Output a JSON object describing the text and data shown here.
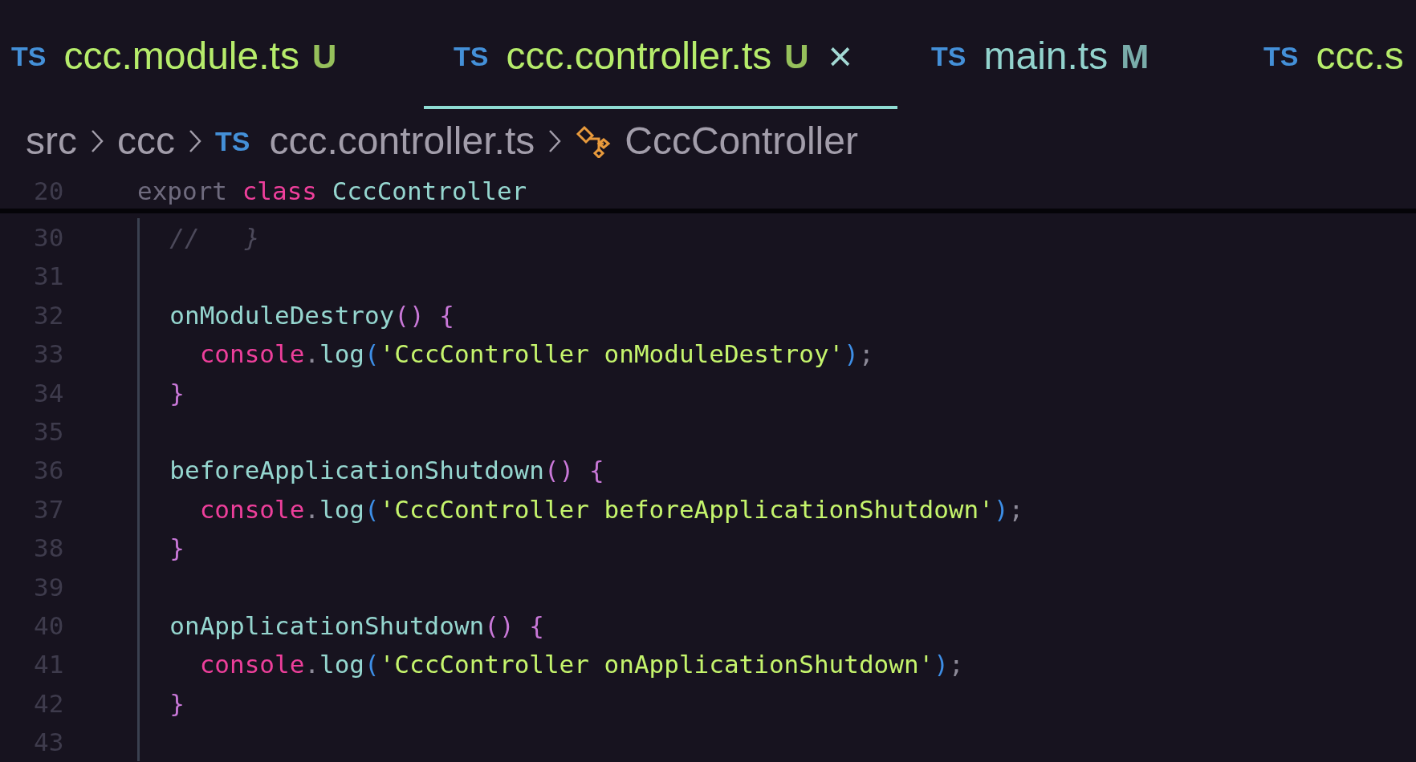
{
  "tabs": [
    {
      "icon": "TS",
      "label": "ccc.module.ts",
      "status": "U",
      "color": "#b6ec6b",
      "selected": false,
      "closable": false
    },
    {
      "icon": "TS",
      "label": "ccc.controller.ts",
      "status": "U",
      "color": "#b6ec6b",
      "selected": true,
      "closable": true,
      "close": "×"
    },
    {
      "icon": "TS",
      "label": "main.ts",
      "status": "M",
      "color": "#92d3cd",
      "selected": false,
      "closable": false
    },
    {
      "icon": "TS",
      "label": "ccc.s",
      "color": "#b6ec6b",
      "selected": false,
      "closable": false
    }
  ],
  "breadcrumb": [
    {
      "kind": "folder",
      "label": "src"
    },
    {
      "kind": "folder",
      "label": "ccc"
    },
    {
      "kind": "file",
      "icon": "TS",
      "label": "ccc.controller.ts"
    },
    {
      "kind": "symbol",
      "label": "CccController"
    }
  ],
  "sticky_line": {
    "number": "20",
    "tokens": [
      {
        "kind": "muted",
        "text": "export "
      },
      {
        "kind": "keyword",
        "text": "class "
      },
      {
        "kind": "function",
        "text": "CccController"
      }
    ]
  },
  "lines": [
    {
      "number": "30",
      "tokens": [
        {
          "kind": "comment",
          "text": "  //   }"
        }
      ]
    },
    {
      "number": "31"
    },
    {
      "number": "32",
      "tokens": [
        {
          "kind": "function",
          "text": "  onModuleDestroy"
        },
        {
          "kind": "bracket",
          "text": "() {"
        }
      ]
    },
    {
      "number": "33",
      "tokens": [
        {
          "kind": "keyword",
          "text": "    console"
        },
        {
          "kind": "punct",
          "text": "."
        },
        {
          "kind": "function",
          "text": "log"
        },
        {
          "kind": "paren",
          "text": "("
        },
        {
          "kind": "string",
          "text": "'CccController onModuleDestroy'"
        },
        {
          "kind": "paren",
          "text": ")"
        },
        {
          "kind": "punct",
          "text": ";"
        }
      ]
    },
    {
      "number": "34",
      "tokens": [
        {
          "kind": "bracket",
          "text": "  }"
        }
      ]
    },
    {
      "number": "35"
    },
    {
      "number": "36",
      "tokens": [
        {
          "kind": "function",
          "text": "  beforeApplicationShutdown"
        },
        {
          "kind": "bracket",
          "text": "() {"
        }
      ]
    },
    {
      "number": "37",
      "tokens": [
        {
          "kind": "keyword",
          "text": "    console"
        },
        {
          "kind": "punct",
          "text": "."
        },
        {
          "kind": "function",
          "text": "log"
        },
        {
          "kind": "paren",
          "text": "("
        },
        {
          "kind": "string",
          "text": "'CccController beforeApplicationShutdown'"
        },
        {
          "kind": "paren",
          "text": ")"
        },
        {
          "kind": "punct",
          "text": ";"
        }
      ]
    },
    {
      "number": "38",
      "tokens": [
        {
          "kind": "bracket",
          "text": "  }"
        }
      ]
    },
    {
      "number": "39"
    },
    {
      "number": "40",
      "tokens": [
        {
          "kind": "function",
          "text": "  onApplicationShutdown"
        },
        {
          "kind": "bracket",
          "text": "() {"
        }
      ]
    },
    {
      "number": "41",
      "tokens": [
        {
          "kind": "keyword",
          "text": "    console"
        },
        {
          "kind": "punct",
          "text": "."
        },
        {
          "kind": "function",
          "text": "log"
        },
        {
          "kind": "paren",
          "text": "("
        },
        {
          "kind": "string",
          "text": "'CccController onApplicationShutdown'"
        },
        {
          "kind": "paren",
          "text": ")"
        },
        {
          "kind": "punct",
          "text": ";"
        }
      ]
    },
    {
      "number": "42",
      "tokens": [
        {
          "kind": "bracket",
          "text": "  }"
        }
      ]
    },
    {
      "number": "43"
    }
  ]
}
